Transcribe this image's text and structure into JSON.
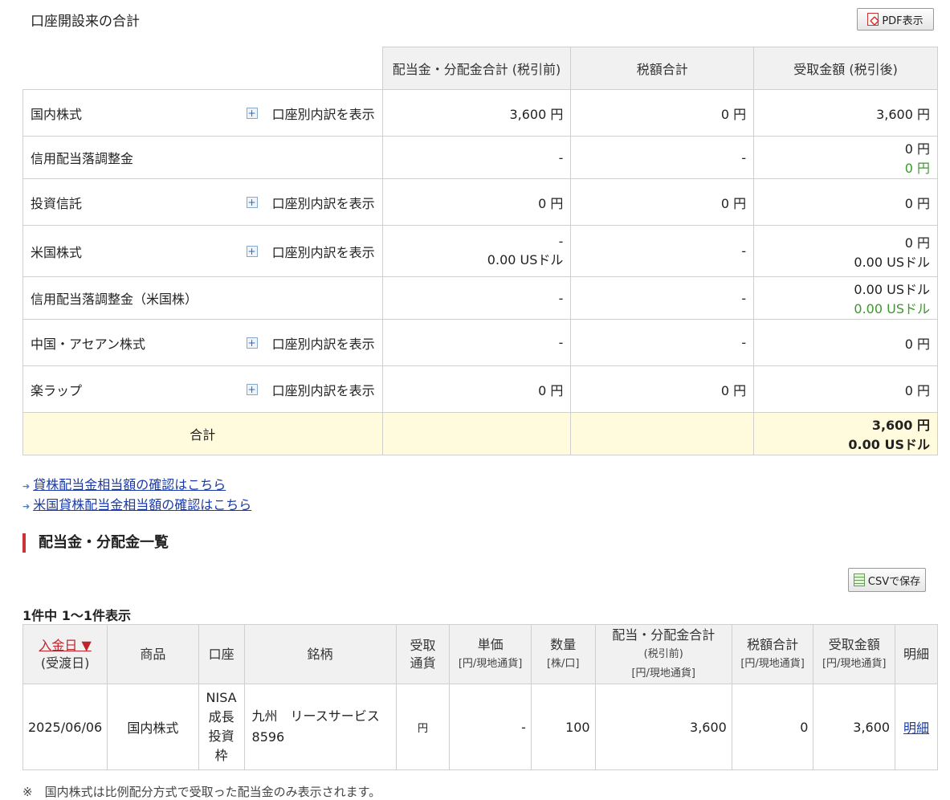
{
  "summary": {
    "title": "口座開設来の合計",
    "pdf_button": "PDF表示",
    "headers": [
      "配当金・分配金合計 (税引前)",
      "税額合計",
      "受取金額 (税引後)"
    ],
    "breakdown_label": "口座別内訳を表示",
    "rows": [
      {
        "label": "国内株式",
        "toggle": true,
        "pre_tax": [
          "3,600 円"
        ],
        "tax": [
          "0 円"
        ],
        "received": [
          "3,600 円"
        ],
        "received_green": ""
      },
      {
        "label": "信用配当落調整金",
        "toggle": false,
        "pre_tax": [
          "-"
        ],
        "tax": [
          "-"
        ],
        "received": [
          "0 円"
        ],
        "received_green": "0 円"
      },
      {
        "label": "投資信託",
        "toggle": true,
        "pre_tax": [
          "0 円"
        ],
        "tax": [
          "0 円"
        ],
        "received": [
          "0 円"
        ],
        "received_green": ""
      },
      {
        "label": "米国株式",
        "toggle": true,
        "pre_tax": [
          "-",
          "0.00 USドル"
        ],
        "tax": [
          "-"
        ],
        "received": [
          "0 円",
          "0.00 USドル"
        ],
        "received_green": ""
      },
      {
        "label": "信用配当落調整金（米国株）",
        "toggle": false,
        "pre_tax": [
          "-"
        ],
        "tax": [
          "-"
        ],
        "received": [
          "0.00 USドル"
        ],
        "received_green": "0.00 USドル"
      },
      {
        "label": "中国・アセアン株式",
        "toggle": true,
        "pre_tax": [
          "-"
        ],
        "tax": [
          "-"
        ],
        "received": [
          "0 円"
        ],
        "received_green": ""
      },
      {
        "label": "楽ラップ",
        "toggle": true,
        "pre_tax": [
          "0 円"
        ],
        "tax": [
          "0 円"
        ],
        "received": [
          "0 円"
        ],
        "received_green": ""
      }
    ],
    "total": {
      "label": "合計",
      "line1": "3,600 円",
      "line2": "0.00 USドル"
    }
  },
  "links": [
    {
      "text": "貸株配当金相当額の確認はこちら"
    },
    {
      "text": "米国貸株配当金相当額の確認はこちら"
    }
  ],
  "list": {
    "heading": "配当金・分配金一覧",
    "csv_button": "CSVで保存",
    "count_text": "1件中 1〜1件表示",
    "headers": {
      "date": "入金日 ▼",
      "date_sub": "(受渡日)",
      "product": "商品",
      "account": "口座",
      "issue": "銘柄",
      "currency_1": "受取",
      "currency_2": "通貨",
      "unit_price": "単価",
      "unit_price_sub": "[円/現地通貨]",
      "quantity": "数量",
      "quantity_sub": "[株/口]",
      "pre_tax": "配当・分配金合計",
      "pre_tax_sub1": "(税引前)",
      "pre_tax_sub2": "[円/現地通貨]",
      "tax": "税額合計",
      "tax_sub": "[円/現地通貨]",
      "received": "受取金額",
      "received_sub": "[円/現地通貨]",
      "detail": "明細"
    },
    "rows": [
      {
        "date": "2025/06/06",
        "product": "国内株式",
        "account_lines": [
          "NISA",
          "成長",
          "投資",
          "枠"
        ],
        "issue_name": "九州　リースサービス",
        "issue_code": "8596",
        "currency": "円",
        "unit_price": "-",
        "quantity": "100",
        "pre_tax": "3,600",
        "tax": "0",
        "received": "3,600",
        "detail": "明細"
      }
    ],
    "note": "※　国内株式は比例配分方式で受取った配当金のみ表示されます。"
  }
}
